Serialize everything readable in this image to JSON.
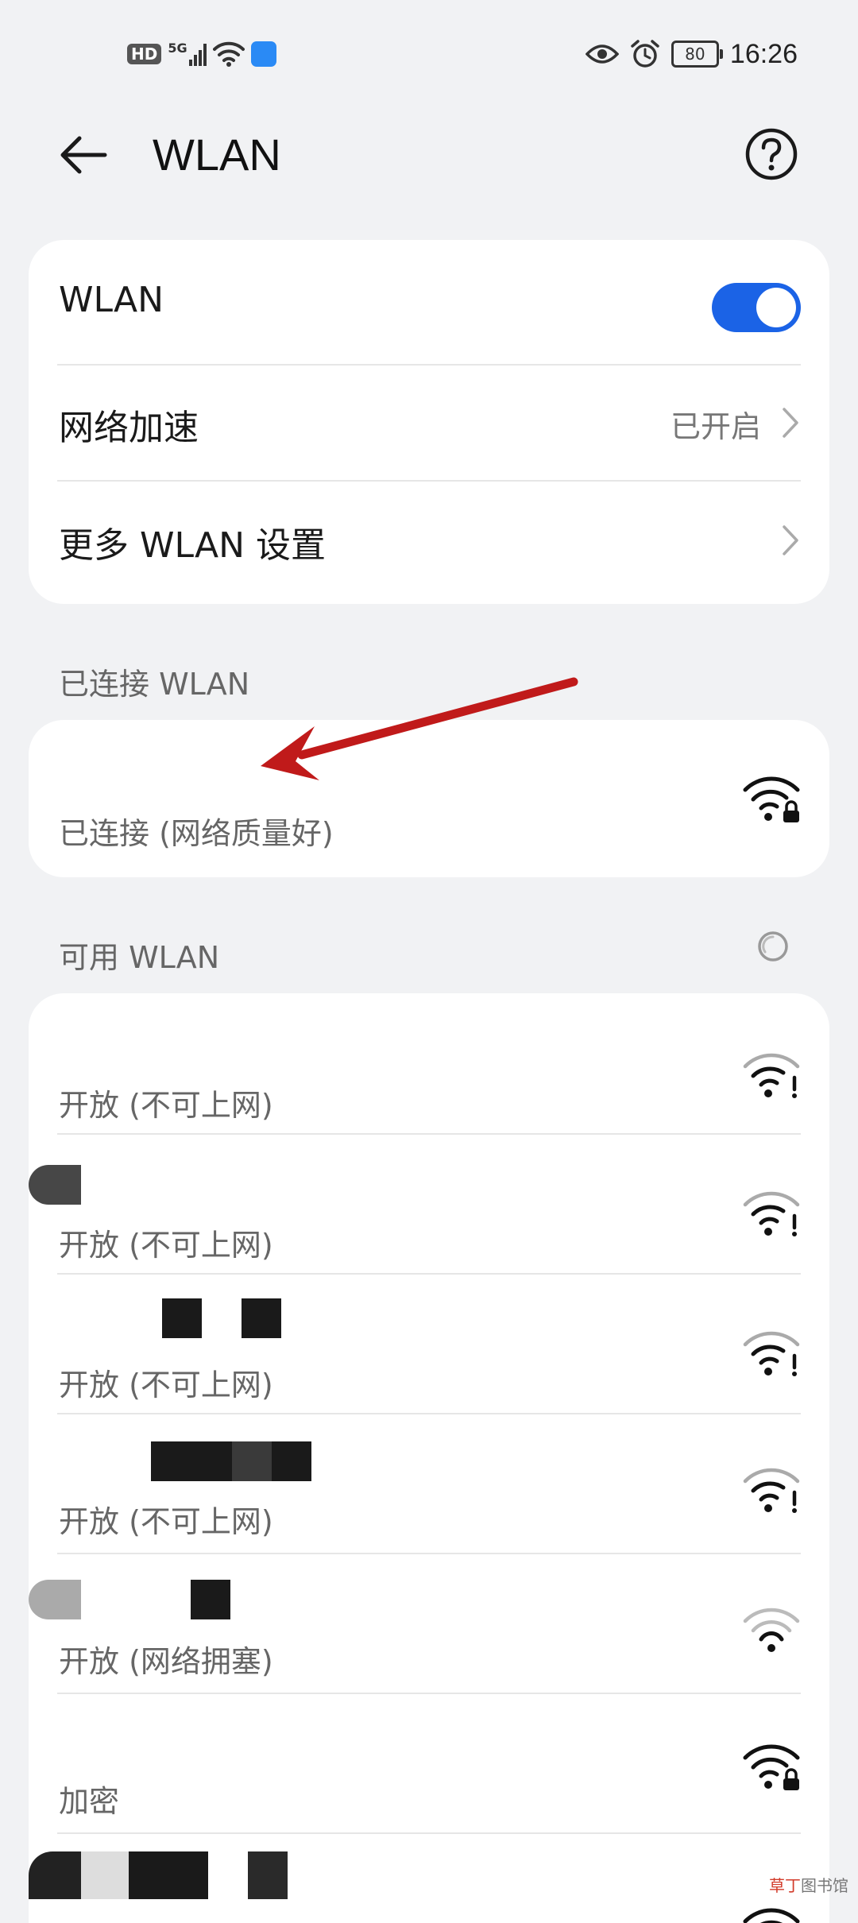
{
  "status_bar": {
    "left_icons": [
      "hd-icon",
      "5g-signal-icon",
      "wifi-status-icon",
      "hotspot-icon"
    ],
    "hd": "HD",
    "network": "5G",
    "right_icons": [
      "eye-icon",
      "alarm-icon",
      "battery-icon"
    ],
    "battery": "80",
    "time": "16:26"
  },
  "app_bar": {
    "title": "WLAN",
    "back_icon": "arrow-left-icon",
    "help_icon": "help-circle-icon"
  },
  "settings": {
    "wlan": {
      "label": "WLAN",
      "enabled": true
    },
    "acceleration": {
      "label": "网络加速",
      "value": "已开启"
    },
    "more": {
      "label": "更多 WLAN 设置"
    }
  },
  "connected": {
    "section_title": "已连接 WLAN",
    "network": {
      "ssid": "",
      "status": "已连接 (网络质量好)",
      "icon": "wifi-lock-icon"
    }
  },
  "available": {
    "section_title": "可用 WLAN",
    "networks": [
      {
        "ssid": "",
        "status": "开放 (不可上网)",
        "icon": "wifi-exclaim-icon"
      },
      {
        "ssid": "",
        "status": "开放 (不可上网)",
        "icon": "wifi-exclaim-icon"
      },
      {
        "ssid": "",
        "status": "开放 (不可上网)",
        "icon": "wifi-exclaim-icon"
      },
      {
        "ssid": "",
        "status": "开放 (不可上网)",
        "icon": "wifi-exclaim-icon"
      },
      {
        "ssid": "",
        "status": "开放 (网络拥塞)",
        "icon": "wifi-weak-icon"
      },
      {
        "ssid": "",
        "status": "加密",
        "icon": "wifi-lock-icon"
      },
      {
        "ssid": "",
        "status": "",
        "icon": "wifi-icon"
      }
    ]
  },
  "watermark": {
    "part1": "草丁",
    "part2": "图书馆"
  },
  "colors": {
    "accent": "#1b63e6",
    "arrow": "#c01a1a",
    "background": "#f1f2f4"
  }
}
